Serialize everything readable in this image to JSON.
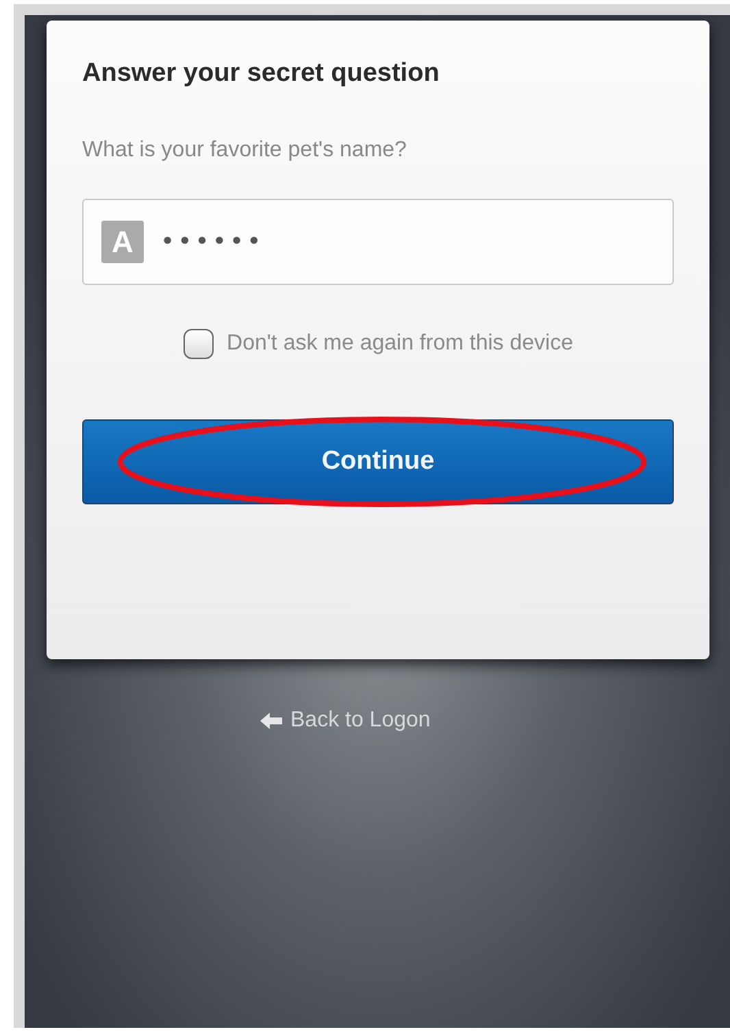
{
  "card": {
    "title": "Answer your secret question",
    "question": "What is your favorite pet's name?",
    "answer_field": {
      "badge": "A",
      "value": "••••••"
    },
    "remember_checkbox": {
      "label": "Don't ask me again from this device",
      "checked": false
    },
    "continue_button": {
      "label": "Continue",
      "circled": true
    }
  },
  "back_link": {
    "label": "Back to Logon"
  }
}
